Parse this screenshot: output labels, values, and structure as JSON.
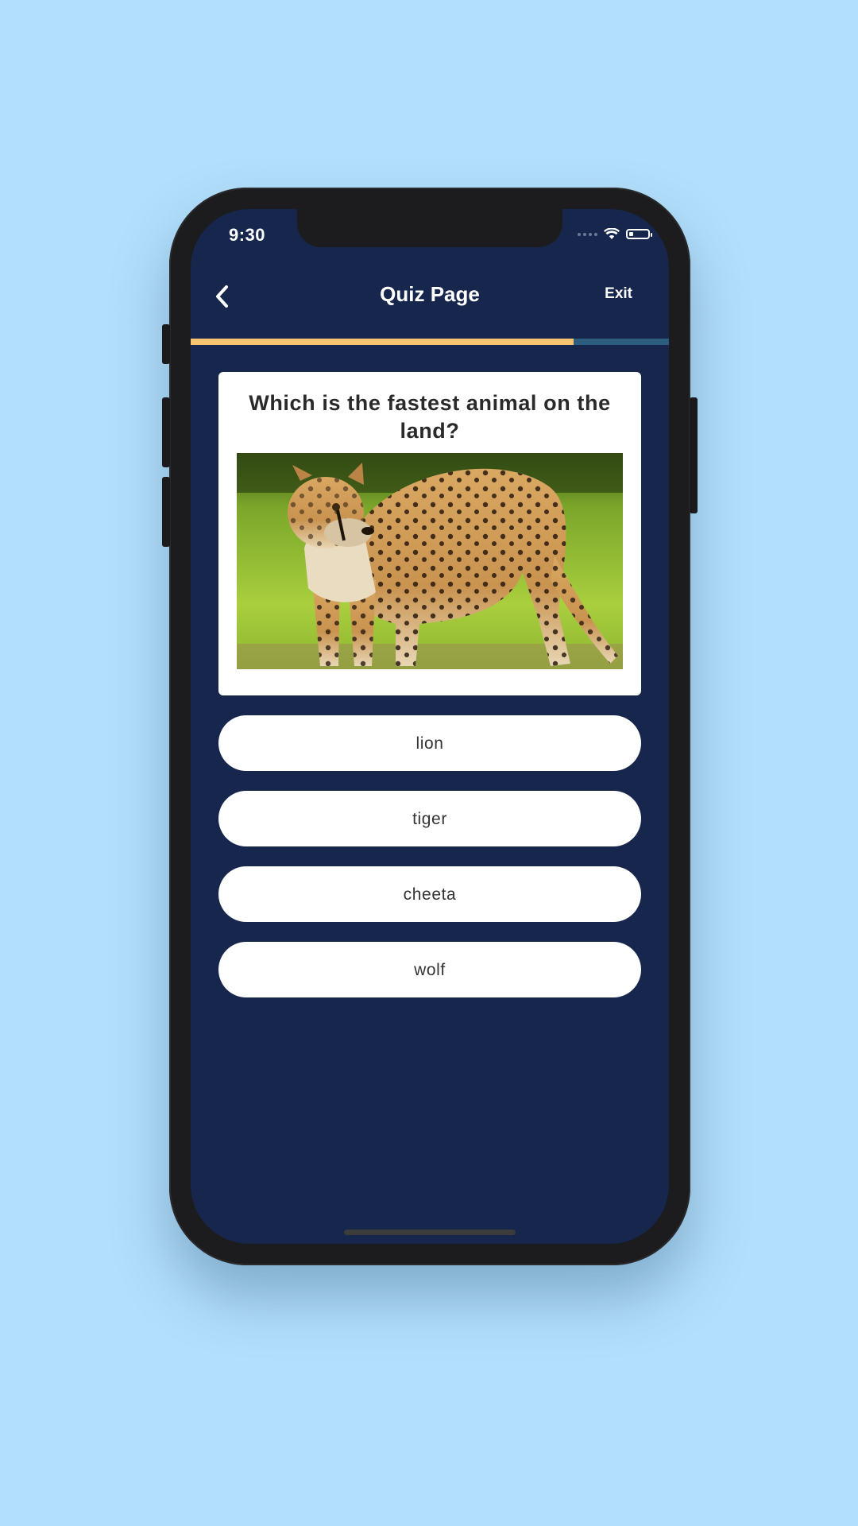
{
  "status_bar": {
    "time": "9:30",
    "icons": [
      "signal-dots-icon",
      "wifi-icon",
      "battery-icon"
    ]
  },
  "header": {
    "back_icon": "chevron-left-icon",
    "title": "Quiz Page",
    "exit_label": "Exit"
  },
  "progress": {
    "fraction": 0.8
  },
  "question": {
    "text": "Which is the fastest animal on the land?",
    "image": "cheetah-photo"
  },
  "answers": [
    {
      "label": "lion"
    },
    {
      "label": "tiger"
    },
    {
      "label": "cheeta"
    },
    {
      "label": "wolf"
    }
  ],
  "colors": {
    "page_background": "#b2dffb",
    "screen_background": "#16264d",
    "progress_fill": "#f5c571",
    "progress_track": "#2c5c7e",
    "card_background": "#ffffff"
  }
}
